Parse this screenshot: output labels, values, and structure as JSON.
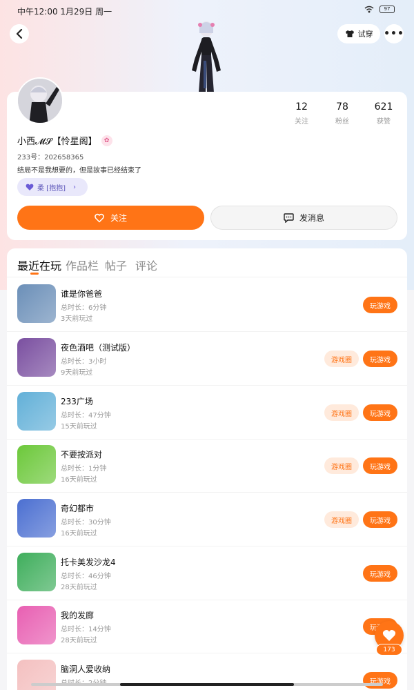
{
  "status_bar": {
    "time": "中午12:00 1月29日 周一",
    "battery": "97"
  },
  "header": {
    "try_on_label": "试穿",
    "more_label": "•••"
  },
  "profile": {
    "stats": [
      {
        "value": "12",
        "label": "关注"
      },
      {
        "value": "78",
        "label": "粉丝"
      },
      {
        "value": "621",
        "label": "获赞"
      }
    ],
    "name": "小西𝓜𝓢【怜星阁】",
    "uid": "233号：202658365",
    "bio": "结局不是我想要的，但是故事已经结束了",
    "tag_label": "柔 [抱抱]",
    "follow_label": "关注",
    "message_label": "发消息"
  },
  "tabs": [
    {
      "label": "最近在玩",
      "active": true
    },
    {
      "label": "作品栏",
      "active": false
    },
    {
      "label": "帖子",
      "active": false
    },
    {
      "label": "评论",
      "active": false
    }
  ],
  "games": [
    {
      "title": "谁是你爸爸",
      "duration": "总时长：6分钟",
      "last_played": "3天前玩过",
      "has_circle": false,
      "thumb_color": "#6b8fb8"
    },
    {
      "title": "夜色酒吧（测试版）",
      "duration": "总时长：3小时",
      "last_played": "9天前玩过",
      "has_circle": true,
      "thumb_color": "#7a4fa0"
    },
    {
      "title": "233广场",
      "duration": "总时长：47分钟",
      "last_played": "15天前玩过",
      "has_circle": true,
      "thumb_color": "#62b0d8"
    },
    {
      "title": "不要按派对",
      "duration": "总时长：1分钟",
      "last_played": "16天前玩过",
      "has_circle": true,
      "thumb_color": "#6cc83a"
    },
    {
      "title": "奇幻都市",
      "duration": "总时长：30分钟",
      "last_played": "16天前玩过",
      "has_circle": true,
      "thumb_color": "#4b6fd1"
    },
    {
      "title": "托卡美发沙龙4",
      "duration": "总时长：46分钟",
      "last_played": "28天前玩过",
      "has_circle": false,
      "thumb_color": "#3fae5c"
    },
    {
      "title": "我的发廊",
      "duration": "总时长：14分钟",
      "last_played": "28天前玩过",
      "has_circle": false,
      "thumb_color": "#e85fb2"
    },
    {
      "title": "脑洞人爱收纳",
      "duration": "总时长：2分钟",
      "last_played": "",
      "has_circle": false,
      "thumb_color": "#f4c0c0"
    }
  ],
  "labels": {
    "play": "玩游戏",
    "circle": "游戏圈"
  },
  "like_float": {
    "count": "173"
  },
  "colors": {
    "accent": "#ff7416",
    "accent_light": "#ffeadc"
  }
}
